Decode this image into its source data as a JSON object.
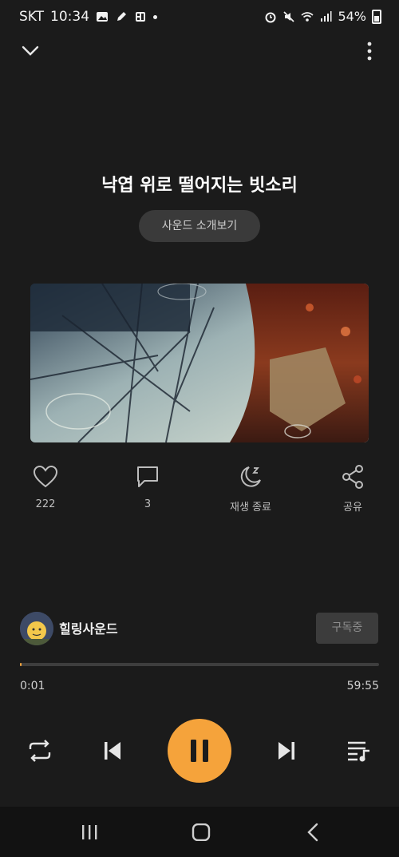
{
  "status_bar": {
    "carrier": "SKT",
    "time": "10:34",
    "battery": "54%"
  },
  "header": {
    "collapse_icon": "chevron-down-icon",
    "menu_icon": "more-vertical-icon"
  },
  "track": {
    "title": "낙엽 위로 떨어지는 빗소리",
    "intro_button": "사운드 소개보기"
  },
  "actions": [
    {
      "icon": "heart-icon",
      "label": "222"
    },
    {
      "icon": "comment-icon",
      "label": "3"
    },
    {
      "icon": "sleep-timer-icon",
      "label": "재생 종료"
    },
    {
      "icon": "share-icon",
      "label": "공유"
    }
  ],
  "channel": {
    "name": "힐링사운드",
    "subscribe_label": "구독중"
  },
  "player": {
    "current_time": "0:01",
    "total_time": "59:55",
    "progress": 0.0003,
    "accent": "#f5a33b"
  }
}
